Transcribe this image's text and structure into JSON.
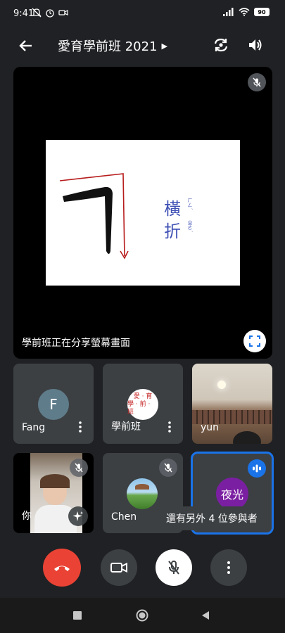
{
  "status_bar": {
    "time": "9:41",
    "battery": "90"
  },
  "header": {
    "title": "愛育學前班 2021"
  },
  "main": {
    "share_label": "學前班正在分享螢幕畫面",
    "slide": {
      "char1": "橫",
      "char2": "折",
      "ruby1": "ㄏㄥˊ",
      "ruby2": "ㄓㄜˊ"
    }
  },
  "tiles": {
    "fang": {
      "name": "Fang",
      "initial": "F"
    },
    "preschool": {
      "name": "學前班",
      "logo_line1": "愛 · 育",
      "logo_line2": "學 · 前 · 班"
    },
    "yun": {
      "name": "yun"
    },
    "self": {
      "name": "你"
    },
    "chen": {
      "name": "Chen"
    },
    "yeguang": {
      "name": "夜光"
    }
  },
  "more_participants": "還有另外 4 位參與者",
  "colors": {
    "accent_red": "#ea4335",
    "active_border": "#1a73e8",
    "tile_bg": "#3c4043",
    "avatar_fang": "#5f7c8a",
    "avatar_yeguang": "#7b1fa2"
  }
}
